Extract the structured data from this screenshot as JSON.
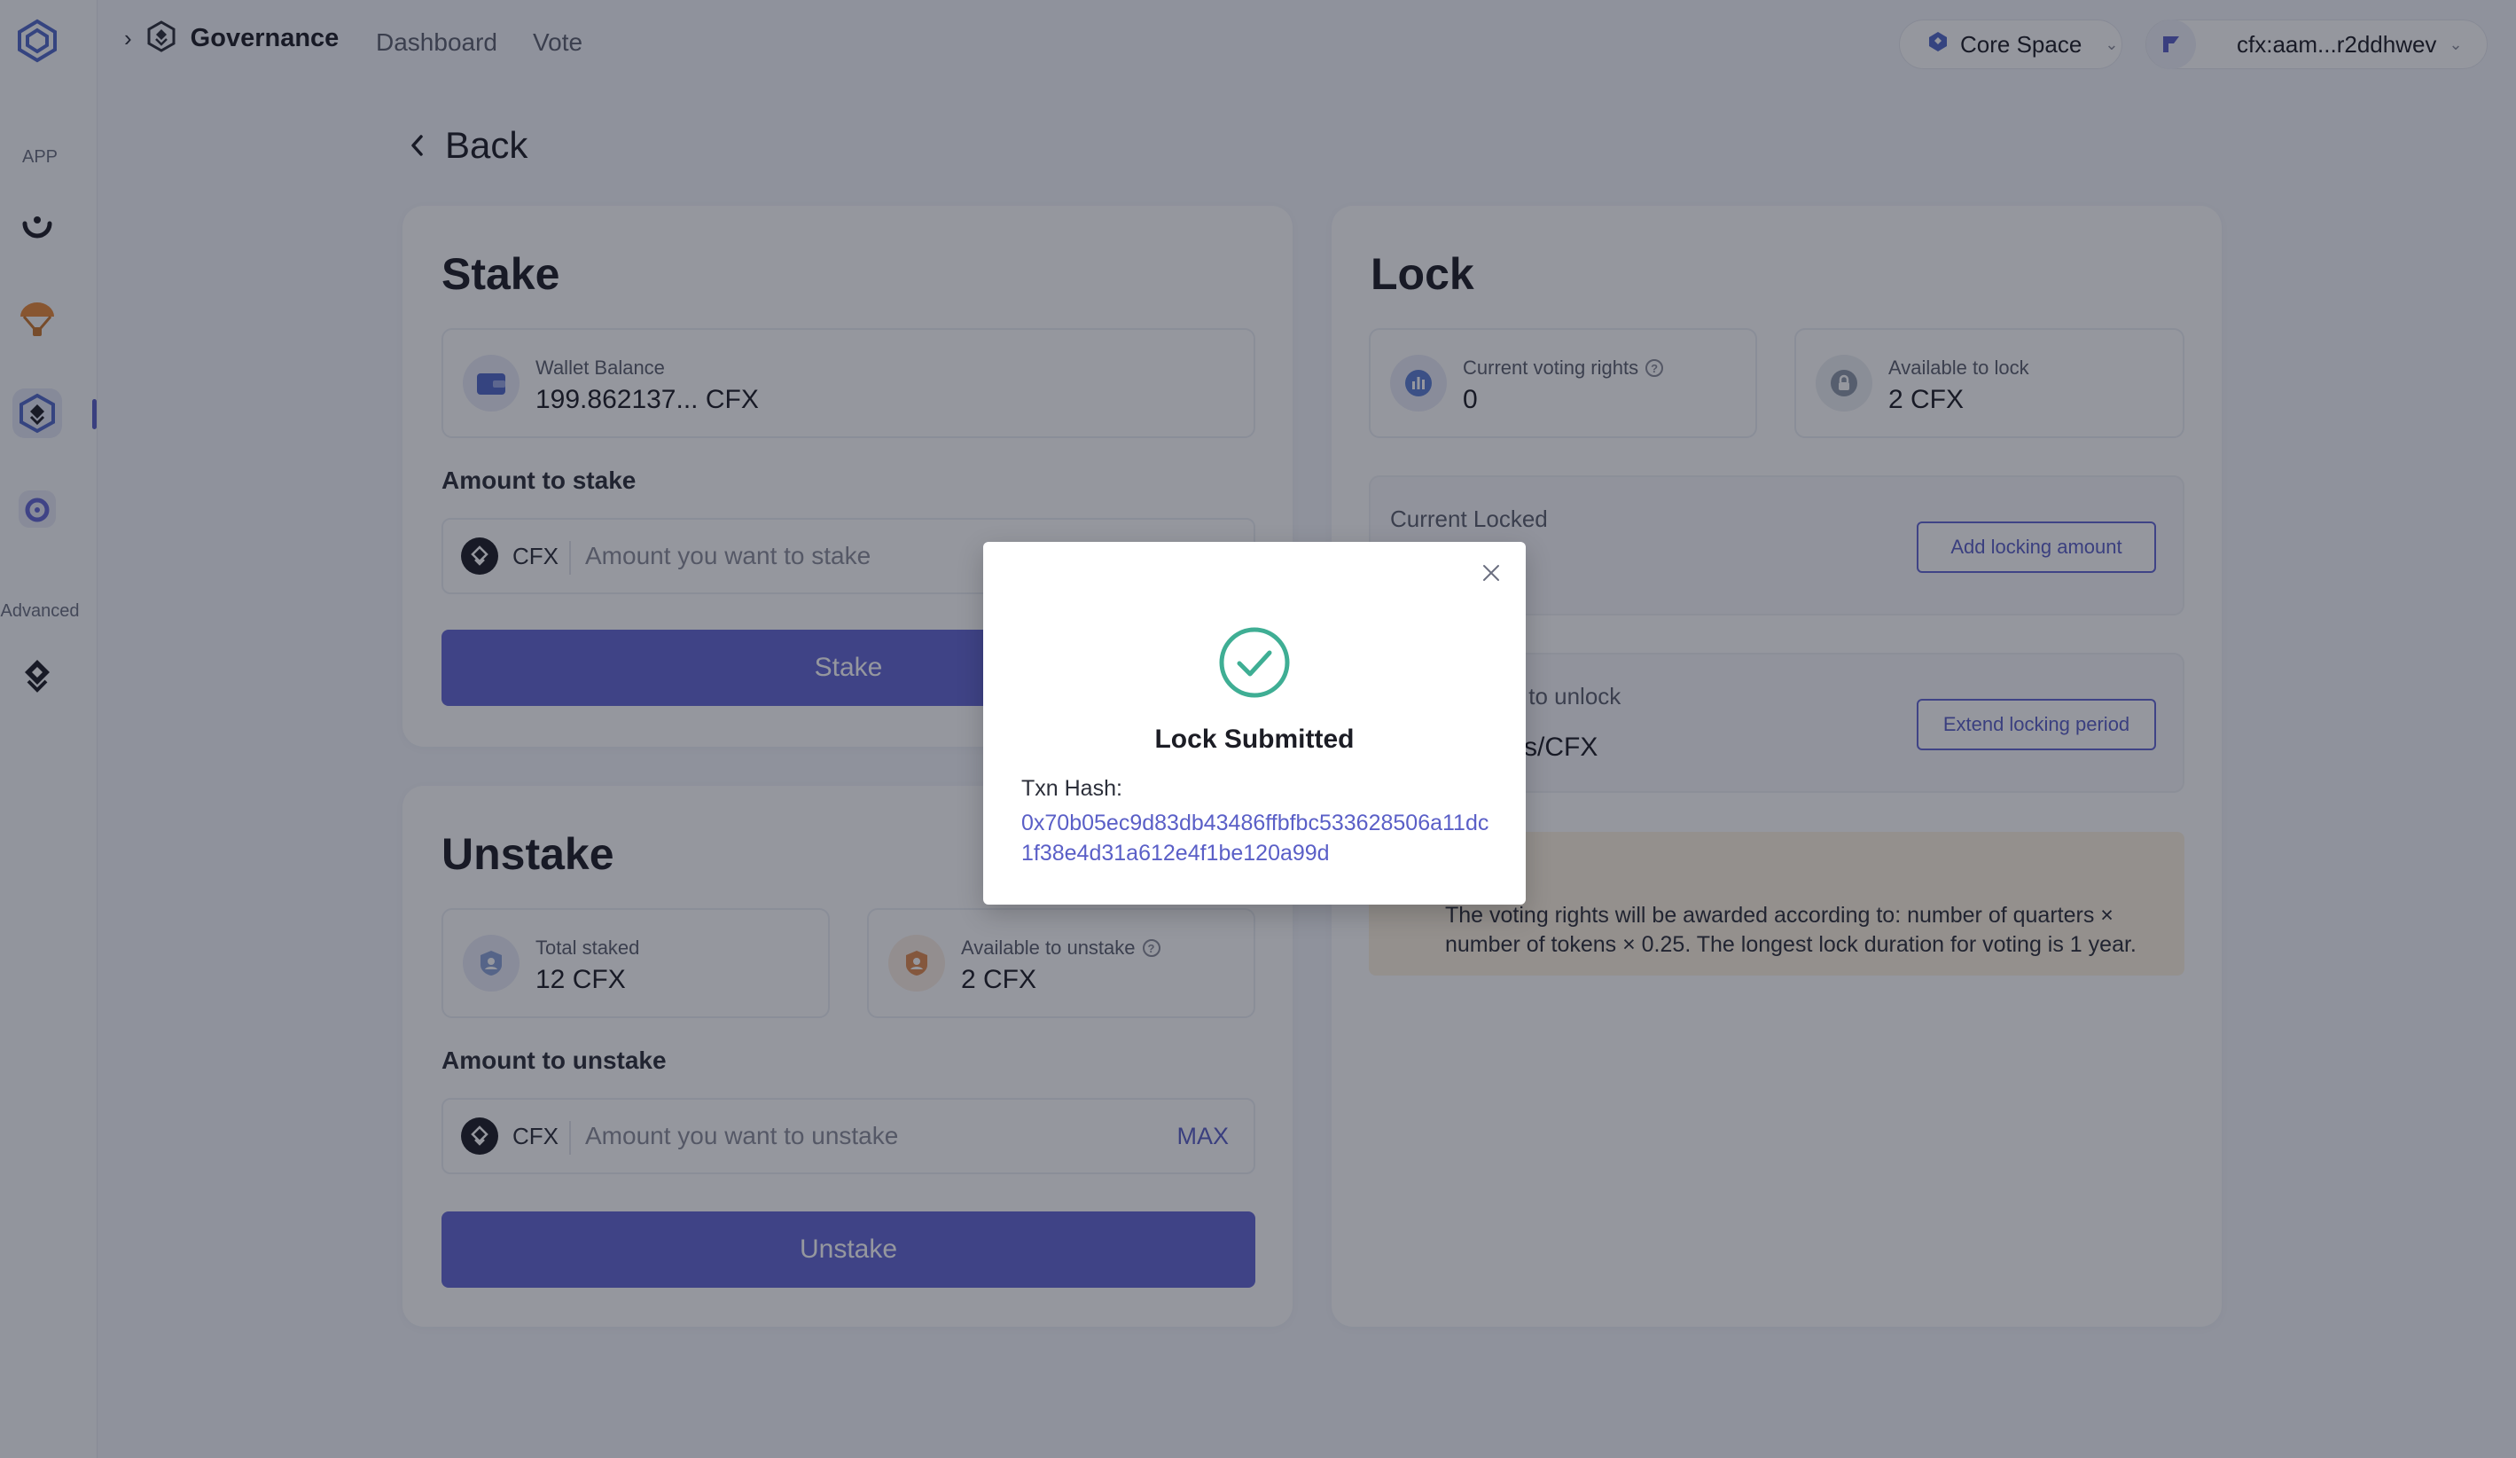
{
  "sidebar": {
    "section_app": "APP",
    "section_advanced": "Advanced"
  },
  "topbar": {
    "title": "Governance",
    "nav": [
      "Dashboard",
      "Vote"
    ],
    "network": "Core Space",
    "account": "cfx:aam...r2ddhwev"
  },
  "back_label": "Back",
  "stake": {
    "title": "Stake",
    "wallet_balance_label": "Wallet Balance",
    "wallet_balance_value": "199.862137... CFX",
    "amount_label": "Amount to stake",
    "token": "CFX",
    "placeholder": "Amount you want to stake",
    "button": "Stake"
  },
  "unstake": {
    "title": "Unstake",
    "total_staked_label": "Total staked",
    "total_staked_value": "12 CFX",
    "available_label": "Available to unstake",
    "available_value": "2 CFX",
    "amount_label": "Amount to unstake",
    "token": "CFX",
    "placeholder": "Amount you want to unstake",
    "max": "MAX",
    "button": "Unstake"
  },
  "lock": {
    "title": "Lock",
    "voting_rights_label": "Current voting rights",
    "voting_rights_value": "0",
    "available_label": "Available to lock",
    "available_value": "2 CFX",
    "current_locked_label": "Current Locked",
    "add_button": "Add locking amount",
    "unlock_label_partial": "s to unlock",
    "unlock_value_partial": "nts/CFX",
    "extend_button": "Extend locking period",
    "notice": "The voting rights will be awarded according to: number of quarters × number of tokens × 0.25. The longest lock duration for voting is 1 year."
  },
  "modal": {
    "title": "Lock Submitted",
    "hash_label": "Txn Hash:",
    "hash": "0x70b05ec9d83db43486ffbfbc533628506a11dc1f38e4d31a612e4f1be120a99d"
  },
  "colors": {
    "accent": "#6367d4",
    "success": "#3fae94",
    "notice_bg": "#fdf2e1"
  }
}
